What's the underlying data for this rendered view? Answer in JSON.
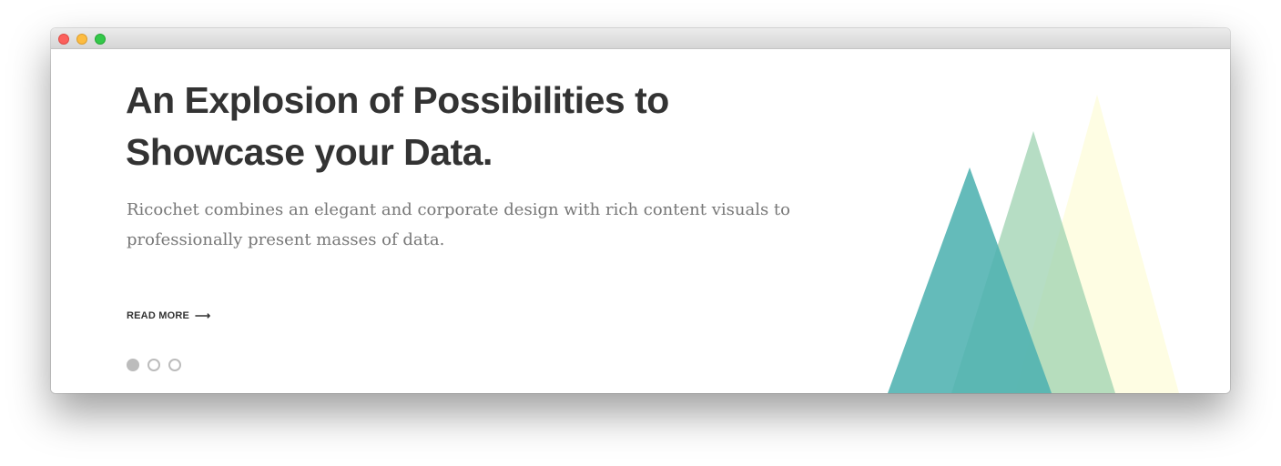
{
  "hero": {
    "headline_line1": "An Explosion of Possibilities to",
    "headline_line2": "Showcase your Data.",
    "description_line1": "Ricochet combines an elegant and corporate design with rich content visuals to",
    "description_line2": "professionally present masses of data.",
    "read_more_label": "READ MORE",
    "read_more_arrow": "⟶"
  },
  "slider": {
    "slide_count": 3,
    "active_slide": 1
  },
  "colors": {
    "triangle_teal": "#62bcbb",
    "triangle_green": "#b0dbc0",
    "triangle_yellow": "#fefde2",
    "heading": "#333333",
    "body_text": "#777777",
    "dot": "#bcbcbc"
  }
}
